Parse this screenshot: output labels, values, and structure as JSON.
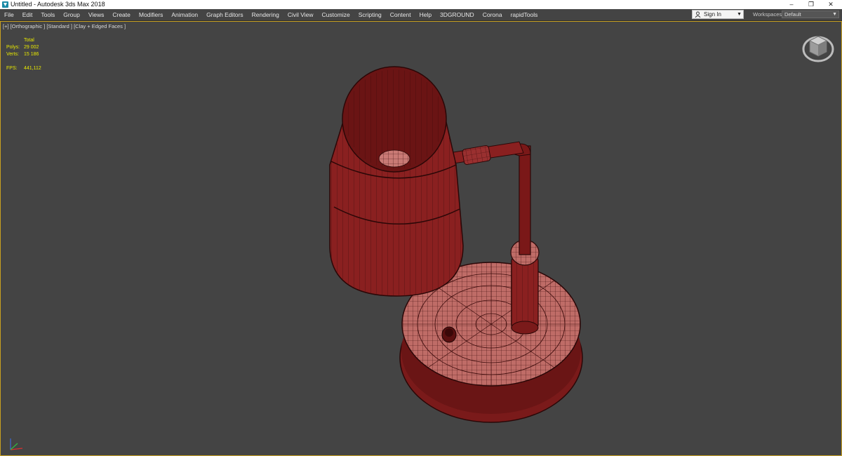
{
  "window": {
    "title": "Untitled - Autodesk 3ds Max 2018",
    "controls": {
      "minimize": "–",
      "restore": "❐",
      "close": "✕"
    }
  },
  "menu": [
    "File",
    "Edit",
    "Tools",
    "Group",
    "Views",
    "Create",
    "Modifiers",
    "Animation",
    "Graph Editors",
    "Rendering",
    "Civil View",
    "Customize",
    "Scripting",
    "Content",
    "Help",
    "3DGROUND",
    "Corona",
    "rapidTools"
  ],
  "account": {
    "sign_in": "Sign In",
    "dropdown": "▼"
  },
  "workspaces": {
    "label": "Workspaces:",
    "value": "Default",
    "dropdown": "▼"
  },
  "viewport": {
    "label": "[+] [Orthographic ] [Standard ] [Clay + Edged Faces ]",
    "stats": {
      "header": "Total",
      "polys_label": "Polys:",
      "polys_value": "29 002",
      "verts_label": "Verts:",
      "verts_value": "15 186",
      "fps_label": "FPS:",
      "fps_value": "441,112"
    }
  },
  "icons": {
    "app": "3dsmax-logo-icon",
    "user": "user-icon",
    "viewcube": "viewcube-icon",
    "axis": "axis-tripod-icon"
  },
  "colors": {
    "viewport_bg": "#444444",
    "clay_red": "#8a2020",
    "wire": "#2a0707",
    "stats_yellow": "#e8e800",
    "active_border": "#c8a020"
  }
}
